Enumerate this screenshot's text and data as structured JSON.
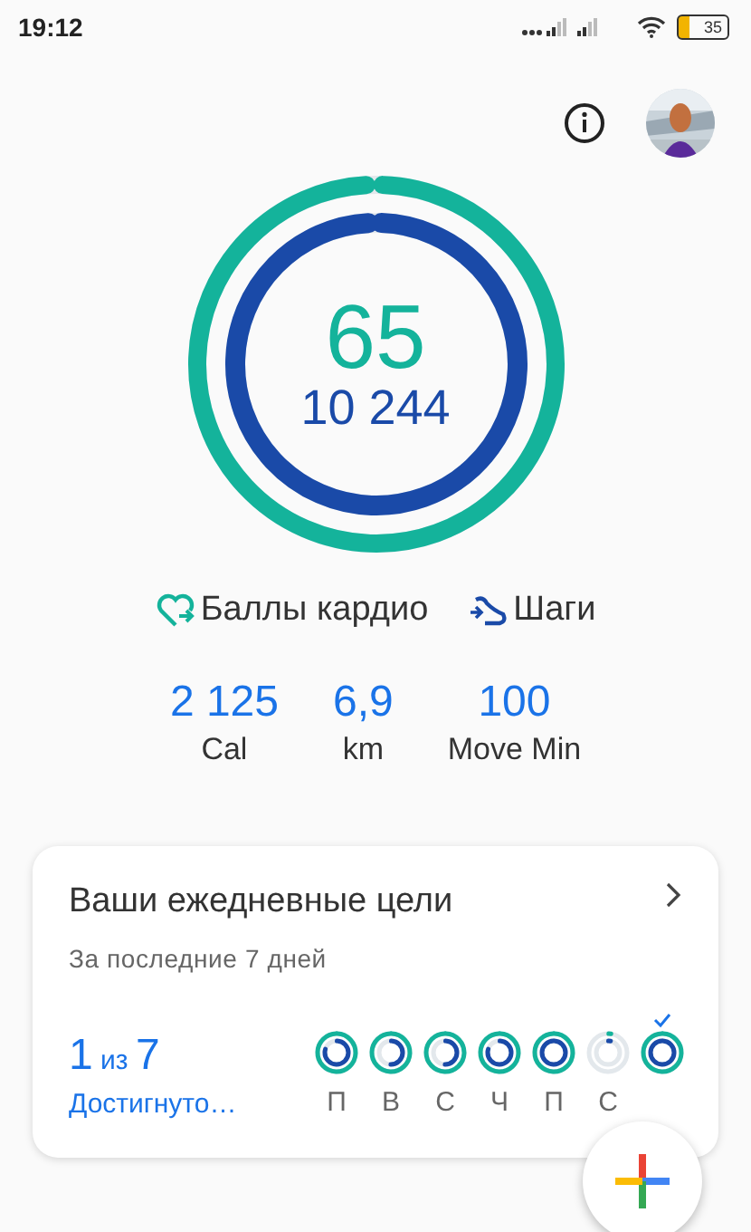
{
  "status_bar": {
    "time": "19:12",
    "battery": "35"
  },
  "rings": [
    {
      "kind": "cardio",
      "level": 1,
      "value": "65"
    },
    {
      "kind": "steps",
      "level": 1,
      "value": "10 244"
    }
  ],
  "legend": [
    {
      "kind": "cardio",
      "label": "Баллы кардио"
    },
    {
      "kind": "steps",
      "label": "Шаги"
    }
  ],
  "stats": [
    {
      "value": "2 125",
      "unit": "Cal"
    },
    {
      "value": "6,9",
      "unit": "km"
    },
    {
      "value": "100",
      "unit": "Move Min"
    }
  ],
  "goals_card": {
    "title": "Ваши ежедневные цели",
    "subtitle": "За последние 7 дней",
    "achieved_count": "1",
    "separator": "из",
    "total": "7",
    "caption": "Достигнуто…",
    "days": [
      {
        "label": "П",
        "achieved": false
      },
      {
        "label": "В",
        "achieved": false
      },
      {
        "label": "С",
        "achieved": false
      },
      {
        "label": "Ч",
        "achieved": false
      },
      {
        "label": "П",
        "achieved": false
      },
      {
        "label": "С",
        "achieved": false
      },
      {
        "achieved": true
      }
    ]
  }
}
